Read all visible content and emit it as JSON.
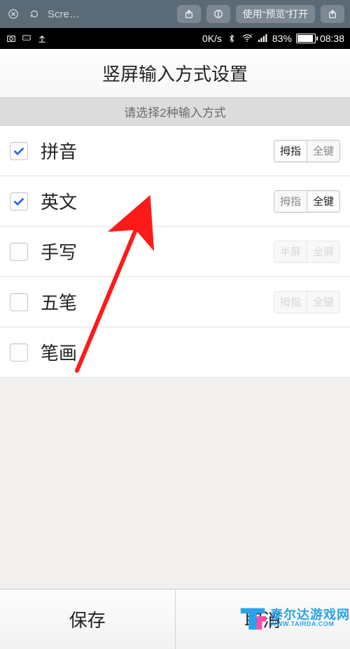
{
  "browser_chrome": {
    "title": "Scre…",
    "open_with_preview": "使用“预览”打开"
  },
  "status_bar": {
    "net_speed": "0K/s",
    "battery_pct": "83%",
    "time": "08:38"
  },
  "header": {
    "title": "竖屏输入方式设置"
  },
  "prompt": "请选择2种输入方式",
  "rows": [
    {
      "label": "拼音",
      "checked": true,
      "seg": {
        "enabled": true,
        "opts": [
          "拇指",
          "全键"
        ],
        "chosen": 0
      }
    },
    {
      "label": "英文",
      "checked": true,
      "seg": {
        "enabled": true,
        "opts": [
          "拇指",
          "全键"
        ],
        "chosen": 1
      }
    },
    {
      "label": "手写",
      "checked": false,
      "seg": {
        "enabled": false,
        "opts": [
          "半屏",
          "全屏"
        ],
        "chosen": -1
      }
    },
    {
      "label": "五笔",
      "checked": false,
      "seg": {
        "enabled": false,
        "opts": [
          "拇指",
          "全键"
        ],
        "chosen": -1
      }
    },
    {
      "label": "笔画",
      "checked": false,
      "seg": null
    }
  ],
  "bottom": {
    "save": "保存",
    "cancel": "取消"
  },
  "watermark": {
    "line1": "泰尔达游戏网",
    "line2": "WWW.TAIRDA.COM"
  }
}
